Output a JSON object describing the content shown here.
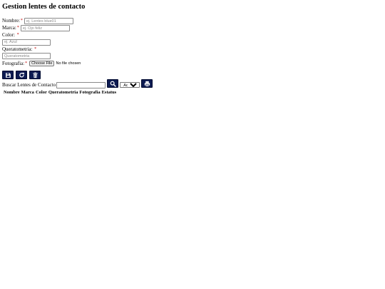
{
  "page": {
    "title": "Gestion lentes de contacto"
  },
  "form": {
    "nombre": {
      "label": "Nombre:",
      "required": "*",
      "placeholder": "ej. Lentes blue01"
    },
    "marca": {
      "label": "Marca:",
      "required": "*",
      "placeholder": "ej. Ojo feliz"
    },
    "color": {
      "label": "Color:",
      "required": "*",
      "placeholder": "ej. Azul"
    },
    "queratometria": {
      "label": "Queratometria:",
      "required": "*",
      "placeholder": "Queratometria"
    },
    "fotografia": {
      "label": "Fotografia:",
      "required": "*",
      "button_label": "Choose File",
      "status_text": "No file chosen"
    }
  },
  "actions": [
    {
      "name": "save-button",
      "icon": "save-icon"
    },
    {
      "name": "reset-button",
      "icon": "redo-icon"
    },
    {
      "name": "delete-button",
      "icon": "trash-icon"
    }
  ],
  "search": {
    "label": "Buscar Lentes de Contacto",
    "value": "",
    "search_icon": "search-icon",
    "status_select": {
      "selected": "Activo",
      "options": [
        "Activo"
      ]
    },
    "print_icon": "print-icon"
  },
  "table": {
    "columns": [
      "Nombre",
      "Marca",
      "Color",
      "Queratometria",
      "Fotografia",
      "Estatus"
    ],
    "rows": []
  },
  "colors": {
    "button_bg": "#0d1b52",
    "required_mark": "#c00000"
  }
}
